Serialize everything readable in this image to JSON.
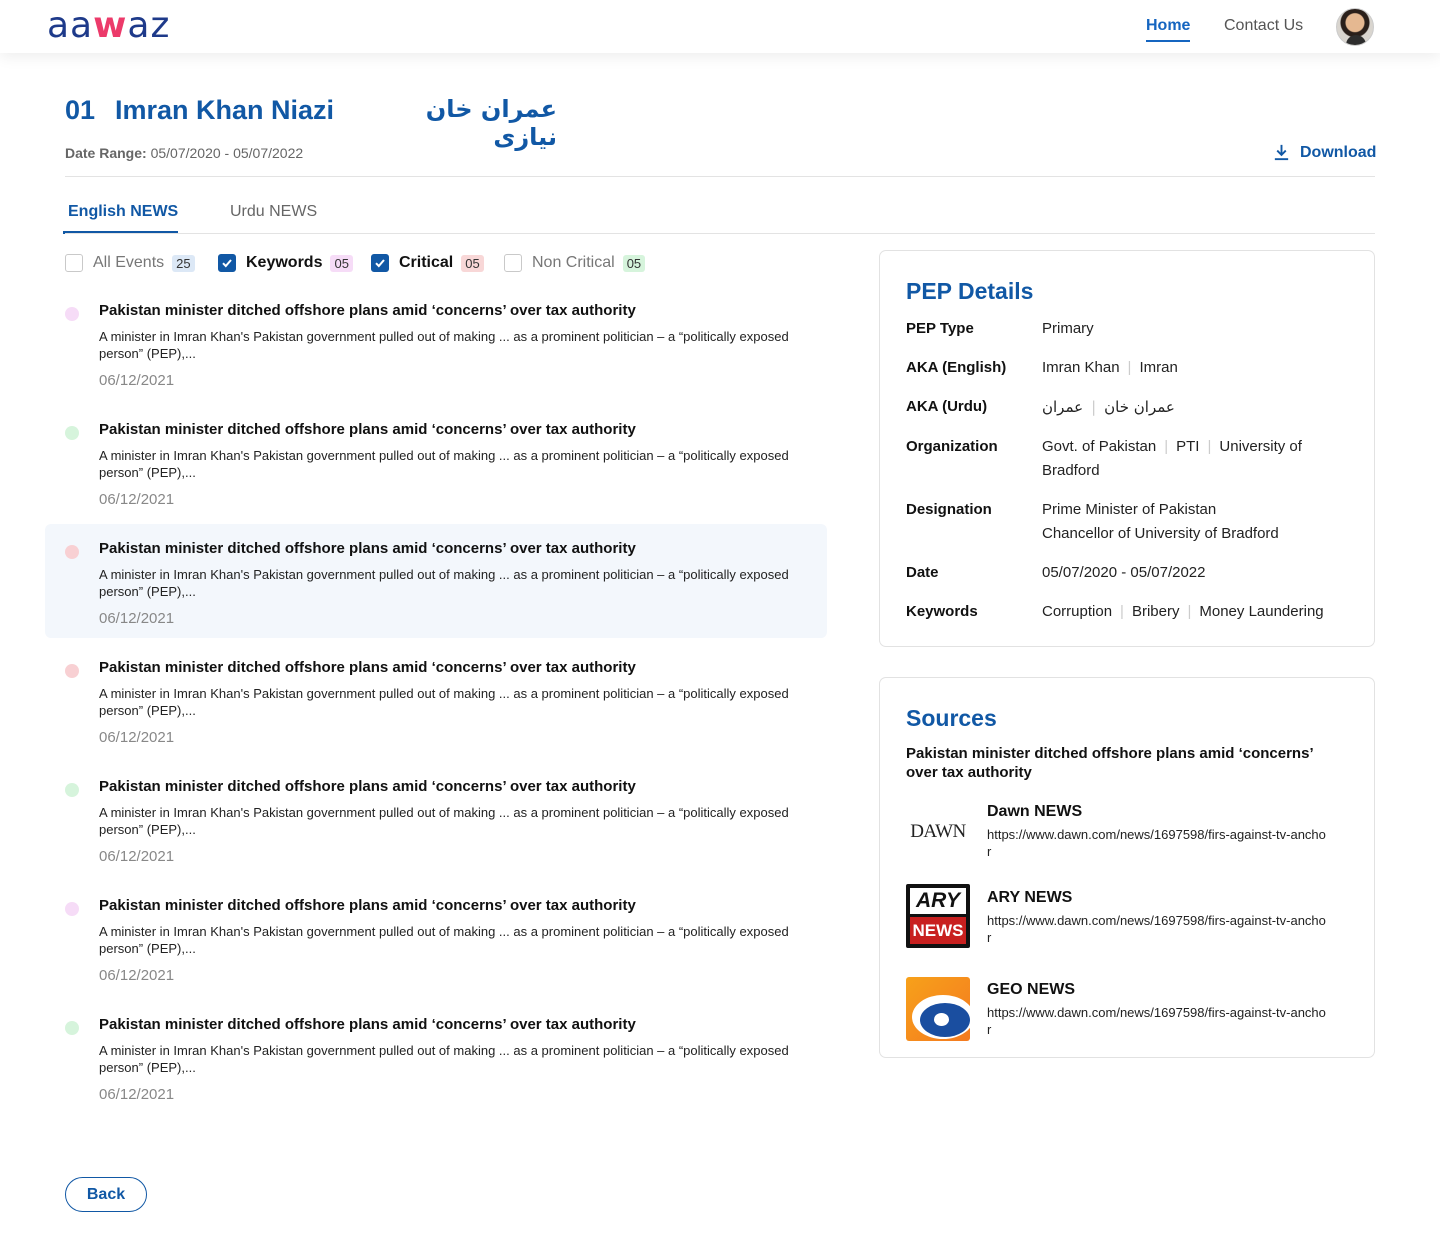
{
  "header": {
    "logo": {
      "part1": "aa",
      "part2": "w",
      "part3": "az"
    },
    "nav": {
      "home": "Home",
      "contact": "Contact Us"
    }
  },
  "profile": {
    "number": "01",
    "name": "Imran Khan Niazi",
    "name_urdu": "عمران خان نیازی",
    "date_range_label": "Date Range:",
    "date_range_value": "05/07/2020 - 05/07/2022",
    "download_label": "Download"
  },
  "tabs": {
    "english": "English NEWS",
    "urdu": "Urdu NEWS"
  },
  "filters": [
    {
      "label": "All Events",
      "count": "25",
      "checked": false,
      "badge_color": "#dce8f6"
    },
    {
      "label": "Keywords",
      "count": "05",
      "checked": true,
      "badge_color": "#f6dcf7"
    },
    {
      "label": "Critical",
      "count": "05",
      "checked": true,
      "badge_color": "#f8d7d7"
    },
    {
      "label": "Non Critical",
      "count": "05",
      "checked": false,
      "badge_color": "#d6f4dc"
    }
  ],
  "news": [
    {
      "title": "Pakistan minister ditched offshore plans amid ‘concerns’ over tax authority",
      "desc": "A minister in Imran Khan's Pakistan government pulled out of making ... as a prominent politician – a “politically exposed person” (PEP),...",
      "date": "06/12/2021",
      "dot_color": "#f6dcf7"
    },
    {
      "title": "Pakistan minister ditched offshore plans amid ‘concerns’ over tax authority",
      "desc": "A minister in Imran Khan's Pakistan government pulled out of making ... as a prominent politician – a “politically exposed person” (PEP),...",
      "date": "06/12/2021",
      "dot_color": "#d6f4dc"
    },
    {
      "title": "Pakistan minister ditched offshore plans amid ‘concerns’ over tax authority",
      "desc": "A minister in Imran Khan's Pakistan government pulled out of making ... as a prominent politician – a “politically exposed person” (PEP),...",
      "date": "06/12/2021",
      "dot_color": "#f8d0d3"
    },
    {
      "title": "Pakistan minister ditched offshore plans amid ‘concerns’ over tax authority",
      "desc": "A minister in Imran Khan's Pakistan government pulled out of making ... as a prominent politician – a “politically exposed person” (PEP),...",
      "date": "06/12/2021",
      "dot_color": "#f8d0d3"
    },
    {
      "title": "Pakistan minister ditched offshore plans amid ‘concerns’ over tax authority",
      "desc": "A minister in Imran Khan's Pakistan government pulled out of making ... as a prominent politician – a “politically exposed person” (PEP),...",
      "date": "06/12/2021",
      "dot_color": "#d6f4dc"
    },
    {
      "title": "Pakistan minister ditched offshore plans amid ‘concerns’ over tax authority",
      "desc": "A minister in Imran Khan's Pakistan government pulled out of making ... as a prominent politician – a “politically exposed person” (PEP),...",
      "date": "06/12/2021",
      "dot_color": "#f6dcf7"
    },
    {
      "title": "Pakistan minister ditched offshore plans amid ‘concerns’ over tax authority",
      "desc": "A minister in Imran Khan's Pakistan government pulled out of making ... as a prominent politician – a “politically exposed person” (PEP),...",
      "date": "06/12/2021",
      "dot_color": "#d6f4dc"
    }
  ],
  "pep": {
    "title": "PEP Details",
    "pep_type": {
      "label": "PEP Type",
      "value": "Primary"
    },
    "aka_en": {
      "label": "AKA (English)",
      "v1": "Imran Khan",
      "v2": "Imran"
    },
    "aka_ur": {
      "label": "AKA (Urdu)",
      "v1": "عمران خان",
      "v2": "عمران"
    },
    "organization": {
      "label": "Organization",
      "v1": "Govt. of Pakistan",
      "v2": "PTI",
      "v3": "University of Bradford"
    },
    "designation": {
      "label": "Designation",
      "v1": "Prime Minister of Pakistan",
      "v2": "Chancellor of University of Bradford"
    },
    "date": {
      "label": "Date",
      "value": "05/07/2020 - 05/07/2022"
    },
    "keywords": {
      "label": "Keywords",
      "v1": "Corruption",
      "v2": "Bribery",
      "v3": "Money Laundering"
    }
  },
  "sources": {
    "title": "Sources",
    "headline": "Pakistan minister ditched offshore plans amid ‘concerns’ over tax authority",
    "items": [
      {
        "name": "Dawn NEWS",
        "url": "https://www.dawn.com/news/1697598/firs-against-tv-anchor",
        "logo_text": "DAWN"
      },
      {
        "name": "ARY NEWS",
        "url": "https://www.dawn.com/news/1697598/firs-against-tv-anchor",
        "logo_text1": "ARY",
        "logo_text2": "NEWS"
      },
      {
        "name": "GEO NEWS",
        "url": "https://www.dawn.com/news/1697598/firs-against-tv-anchor"
      }
    ]
  },
  "back_label": "Back"
}
